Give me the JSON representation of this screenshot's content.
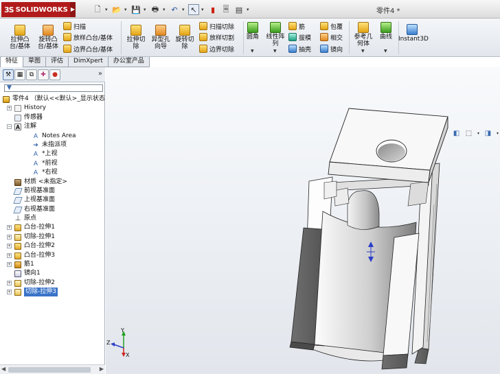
{
  "app": {
    "logo_text": "SOLIDWORKS",
    "document_title": "零件4 *"
  },
  "quick_access": {
    "icons": [
      "new-icon",
      "open-icon",
      "save-icon",
      "print-icon",
      "undo-icon",
      "select-icon",
      "rebuild-icon",
      "file-properties-icon",
      "options-icon"
    ]
  },
  "ribbon": {
    "extruded_boss": "拉伸凸\n台/基体",
    "revolved_boss": "旋转凸\n台/基体",
    "swept_boss": "扫描",
    "lofted_boss": "放样凸台/基体",
    "boundary_boss": "边界凸台/基体",
    "extruded_cut": "拉伸切\n除",
    "hole_wizard": "异型孔\n向导",
    "revolved_cut": "旋转切\n除",
    "swept_cut": "扫描切除",
    "lofted_cut": "放样切割",
    "boundary_cut": "边界切除",
    "fillet": "圆角",
    "linear_pattern": "线性阵\n列",
    "rib": "筋",
    "draft": "拔模",
    "shell": "抽壳",
    "wrap": "包覆",
    "intersect": "相交",
    "mirror": "镜向",
    "reference_geometry": "参考几\n何体",
    "curves": "曲线",
    "instant3d": "Instant3D"
  },
  "tabs": [
    {
      "label": "特征",
      "active": true
    },
    {
      "label": "草图",
      "active": false
    },
    {
      "label": "评估",
      "active": false
    },
    {
      "label": "DimXpert",
      "active": false
    },
    {
      "label": "办公室产品",
      "active": false
    }
  ],
  "feature_tree": {
    "root": "零件4 （默认<<默认>_显示状态",
    "items": [
      {
        "label": "History",
        "icon": "history-icon",
        "expandable": true,
        "indent": 1
      },
      {
        "label": "传感器",
        "icon": "sensor-icon",
        "expandable": false,
        "indent": 1
      },
      {
        "label": "注解",
        "icon": "annotations-icon",
        "expandable": true,
        "expanded": true,
        "indent": 1
      },
      {
        "label": "Notes Area",
        "icon": "notes-area-icon",
        "expandable": false,
        "indent": 3
      },
      {
        "label": "未指派项",
        "icon": "unassigned-items-icon",
        "expandable": false,
        "indent": 3
      },
      {
        "label": "*上视",
        "icon": "top-view-icon",
        "expandable": false,
        "indent": 3
      },
      {
        "label": "*前视",
        "icon": "front-view-icon",
        "expandable": false,
        "indent": 3
      },
      {
        "label": "*右视",
        "icon": "right-view-icon",
        "expandable": false,
        "indent": 3
      },
      {
        "label": "材质 <未指定>",
        "icon": "material-icon",
        "expandable": false,
        "indent": 1
      },
      {
        "label": "前视基准面",
        "icon": "plane-icon",
        "expandable": false,
        "indent": 1
      },
      {
        "label": "上视基准面",
        "icon": "plane-icon",
        "expandable": false,
        "indent": 1
      },
      {
        "label": "右视基准面",
        "icon": "plane-icon",
        "expandable": false,
        "indent": 1
      },
      {
        "label": "原点",
        "icon": "origin-icon",
        "expandable": false,
        "indent": 1
      },
      {
        "label": "凸台-拉伸1",
        "icon": "boss-extrude-icon",
        "expandable": true,
        "indent": 1
      },
      {
        "label": "切除-拉伸1",
        "icon": "cut-extrude-icon",
        "expandable": true,
        "indent": 1
      },
      {
        "label": "凸台-拉伸2",
        "icon": "boss-extrude-icon",
        "expandable": true,
        "indent": 1
      },
      {
        "label": "凸台-拉伸3",
        "icon": "boss-extrude-icon",
        "expandable": true,
        "indent": 1
      },
      {
        "label": "筋1",
        "icon": "rib-icon",
        "expandable": true,
        "indent": 1
      },
      {
        "label": "镜向1",
        "icon": "mirror-icon",
        "expandable": false,
        "indent": 1
      },
      {
        "label": "切除-拉伸2",
        "icon": "cut-extrude-icon",
        "expandable": true,
        "indent": 1
      },
      {
        "label": "切除-拉伸3",
        "icon": "cut-extrude-icon",
        "expandable": true,
        "indent": 1,
        "selected": true
      }
    ]
  },
  "triad": {
    "x": "X",
    "y": "Y",
    "z": "Z"
  }
}
